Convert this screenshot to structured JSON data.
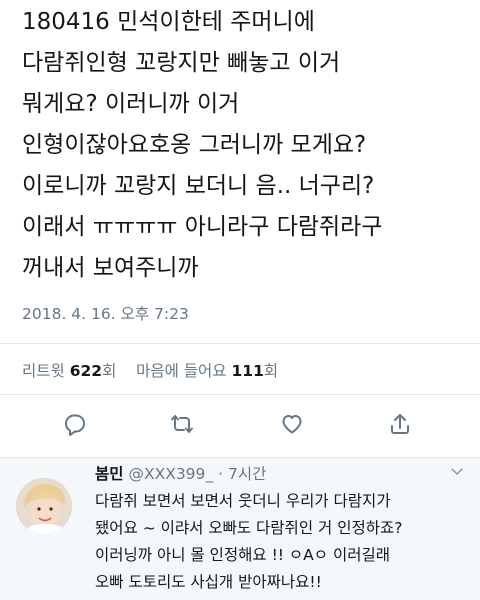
{
  "tweet": {
    "lines": [
      "180416 민석이한테 주머니에",
      "다람쥐인형 꼬랑지만 빼놓고 이거",
      "뭐게요? 이러니까 이거",
      "인형이잖아요호옹 그러니까 모게요?",
      "이로니까 꼬랑지 보더니 음.. 너구리?",
      "이래서 ㅠㅠㅠㅠ 아니라구 다람쥐라구",
      "꺼내서 보여주니까"
    ],
    "timestamp": "2018. 4. 16. 오후 7:23"
  },
  "stats": {
    "retweet_label": "리트윗",
    "retweet_count": "622",
    "retweet_unit": "회",
    "like_label": "마음에 들어요",
    "like_count": "111",
    "like_unit": "회"
  },
  "actions": {
    "icons": [
      "reply-icon",
      "retweet-icon",
      "heart-icon",
      "share-icon"
    ],
    "icon_color": "#657786"
  },
  "reply": {
    "name": "봄민",
    "handle": "@XXX399_",
    "time": "· 7시간",
    "lines": [
      "다람쥐 보면서 보면서 웃더니 우리가 다람지가",
      "됐어요 ~ 이랴서 오빠도 다람쥐인 거 인정하죠?",
      "이러닝까 아니 몰 인정해요 !! ㅇAㅇ 이러길래",
      "오빠 도토리도 사십개 받아짜나요!!"
    ]
  },
  "colors": {
    "text": "#14171a",
    "secondary": "#657786",
    "divider": "#e1e8ed",
    "reply_background": "#f5f8fa"
  }
}
